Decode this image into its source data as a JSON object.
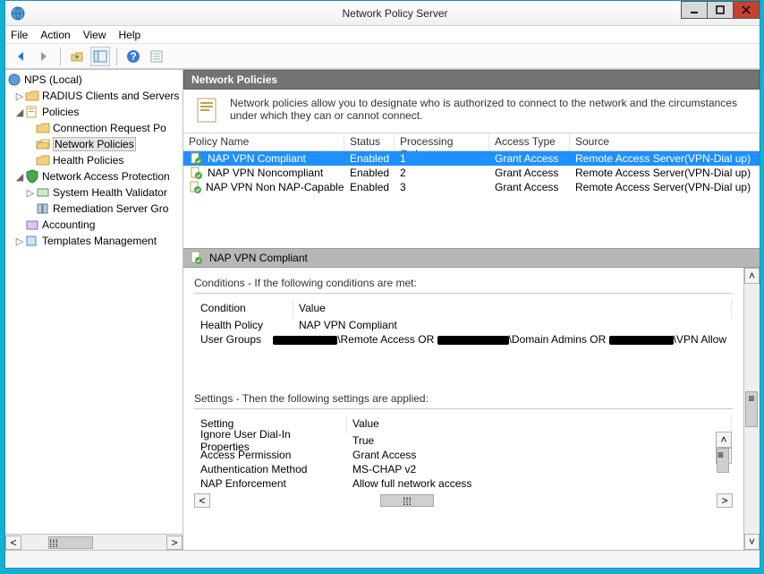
{
  "window": {
    "title": "Network Policy Server"
  },
  "menus": {
    "file": "File",
    "action": "Action",
    "view": "View",
    "help": "Help"
  },
  "tree": {
    "root": "NPS (Local)",
    "radius": "RADIUS Clients and Servers",
    "policies": "Policies",
    "conn": "Connection Request Po",
    "netpol": "Network Policies",
    "health": "Health Policies",
    "nap": "Network Access Protection",
    "shv": "System Health Validator",
    "rem": "Remediation Server Gro",
    "acct": "Accounting",
    "tmpl": "Templates Management"
  },
  "section": {
    "title": "Network Policies",
    "intro": "Network policies allow you to designate who is authorized to connect to the network and the circumstances under which they can or cannot connect."
  },
  "columns": {
    "name": "Policy Name",
    "status": "Status",
    "order": "Processing Order",
    "access": "Access Type",
    "source": "Source"
  },
  "policies": [
    {
      "name": "NAP VPN Compliant",
      "status": "Enabled",
      "order": "1",
      "access": "Grant Access",
      "source": "Remote Access Server(VPN-Dial up)"
    },
    {
      "name": "NAP VPN Noncompliant",
      "status": "Enabled",
      "order": "2",
      "access": "Grant Access",
      "source": "Remote Access Server(VPN-Dial up)"
    },
    {
      "name": "NAP VPN Non NAP-Capable",
      "status": "Enabled",
      "order": "3",
      "access": "Grant Access",
      "source": "Remote Access Server(VPN-Dial up)"
    }
  ],
  "detail": {
    "title": "NAP VPN Compliant",
    "cond_label": "Conditions - If the following conditions are met:",
    "cond_cols": {
      "c": "Condition",
      "v": "Value"
    },
    "conds": [
      {
        "c": "Health Policy",
        "v": "NAP VPN Compliant"
      },
      {
        "c": "User Groups",
        "v_parts": [
          "\\Remote Access OR ",
          "\\Domain Admins OR ",
          "\\VPN Allow"
        ]
      }
    ],
    "set_label": "Settings - Then the following settings are applied:",
    "set_cols": {
      "s": "Setting",
      "v": "Value"
    },
    "settings": [
      {
        "s": "Ignore User Dial-In Properties",
        "v": "True"
      },
      {
        "s": "Access Permission",
        "v": "Grant Access"
      },
      {
        "s": "Authentication Method",
        "v": "MS-CHAP v2"
      },
      {
        "s": "NAP Enforcement",
        "v": "Allow full network access"
      }
    ]
  }
}
